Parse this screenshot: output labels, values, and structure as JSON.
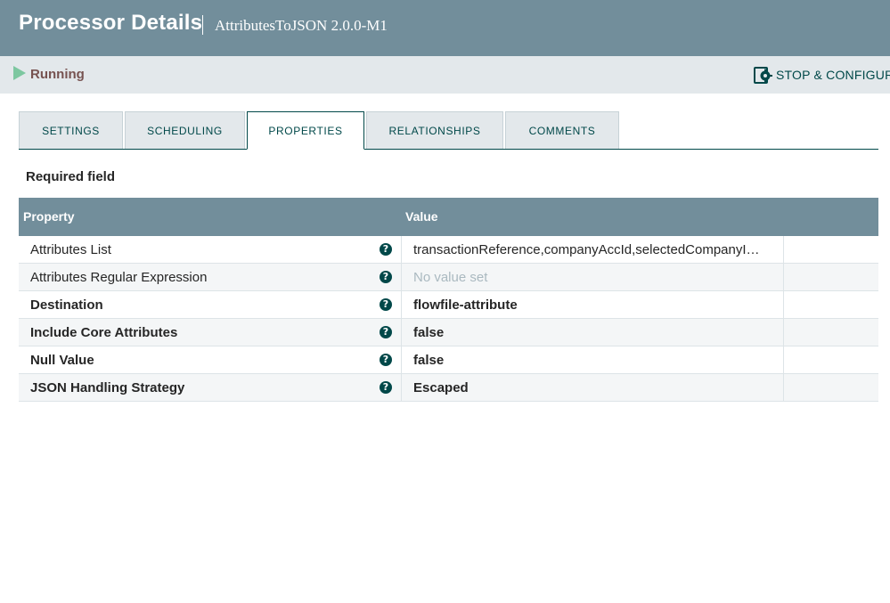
{
  "header": {
    "title": "Processor Details",
    "subtitle": "AttributesToJSON 2.0.0-M1"
  },
  "status": {
    "state": "Running",
    "state_icon": "play-icon",
    "stop_configure_label": "STOP & CONFIGURE"
  },
  "tabs": [
    {
      "label": "SETTINGS",
      "active": false
    },
    {
      "label": "SCHEDULING",
      "active": false
    },
    {
      "label": "PROPERTIES",
      "active": true
    },
    {
      "label": "RELATIONSHIPS",
      "active": false
    },
    {
      "label": "COMMENTS",
      "active": false
    }
  ],
  "required_label": "Required field",
  "table": {
    "columns": [
      "Property",
      "Value"
    ],
    "rows": [
      {
        "name": "Attributes List",
        "required": false,
        "value": "transactionReference,companyAccId,selectedCompanyI…",
        "unset": false
      },
      {
        "name": "Attributes Regular Expression",
        "required": false,
        "value": "No value set",
        "unset": true
      },
      {
        "name": "Destination",
        "required": true,
        "value": "flowfile-attribute",
        "unset": false
      },
      {
        "name": "Include Core Attributes",
        "required": true,
        "value": "false",
        "unset": false
      },
      {
        "name": "Null Value",
        "required": true,
        "value": "false",
        "unset": false
      },
      {
        "name": "JSON Handling Strategy",
        "required": true,
        "value": "Escaped",
        "unset": false
      }
    ],
    "help_glyph": "?"
  },
  "colors": {
    "header_bg": "#728e9b",
    "status_bg": "#e3e8eb",
    "accent": "#004849",
    "running": "#7dc7a0",
    "running_text": "#775351"
  }
}
